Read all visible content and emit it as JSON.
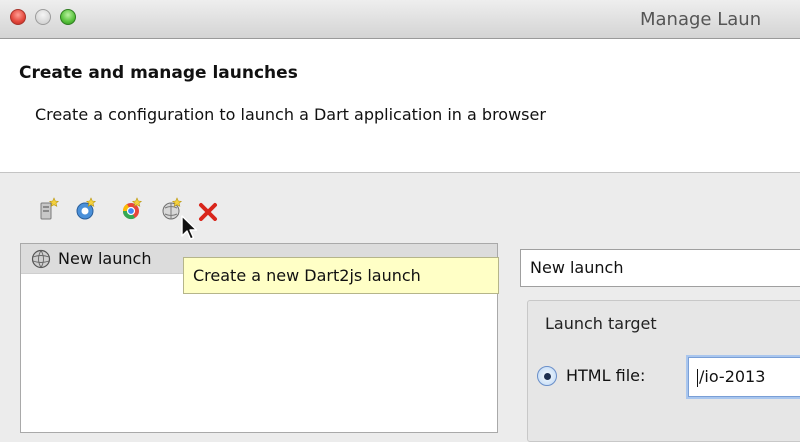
{
  "window": {
    "title": "Manage Laun",
    "controls": [
      "close",
      "minimize",
      "zoom"
    ]
  },
  "header": {
    "title": "Create and manage launches",
    "subtitle": "Create a configuration to launch a Dart application in a browser"
  },
  "toolbar": {
    "items": [
      {
        "name": "new-server-launch-icon",
        "tooltip": ""
      },
      {
        "name": "new-chrome-launch-icon",
        "tooltip": ""
      },
      {
        "name": "new-chrome-app-launch-icon",
        "tooltip": ""
      },
      {
        "name": "new-dart2js-launch-icon",
        "tooltip": "Create a new Dart2js launch"
      },
      {
        "name": "delete-launch-icon",
        "tooltip": ""
      }
    ]
  },
  "launch_list": {
    "items": [
      {
        "label": "New launch",
        "icon": "globe-icon",
        "selected": true
      }
    ]
  },
  "tooltip": {
    "text": "Create a new Dart2js launch"
  },
  "details": {
    "name_value": "New launch",
    "launch_target_label": "Launch target",
    "html_file_label": "HTML file:",
    "html_file_value": "/io-2013",
    "html_file_selected": true
  }
}
